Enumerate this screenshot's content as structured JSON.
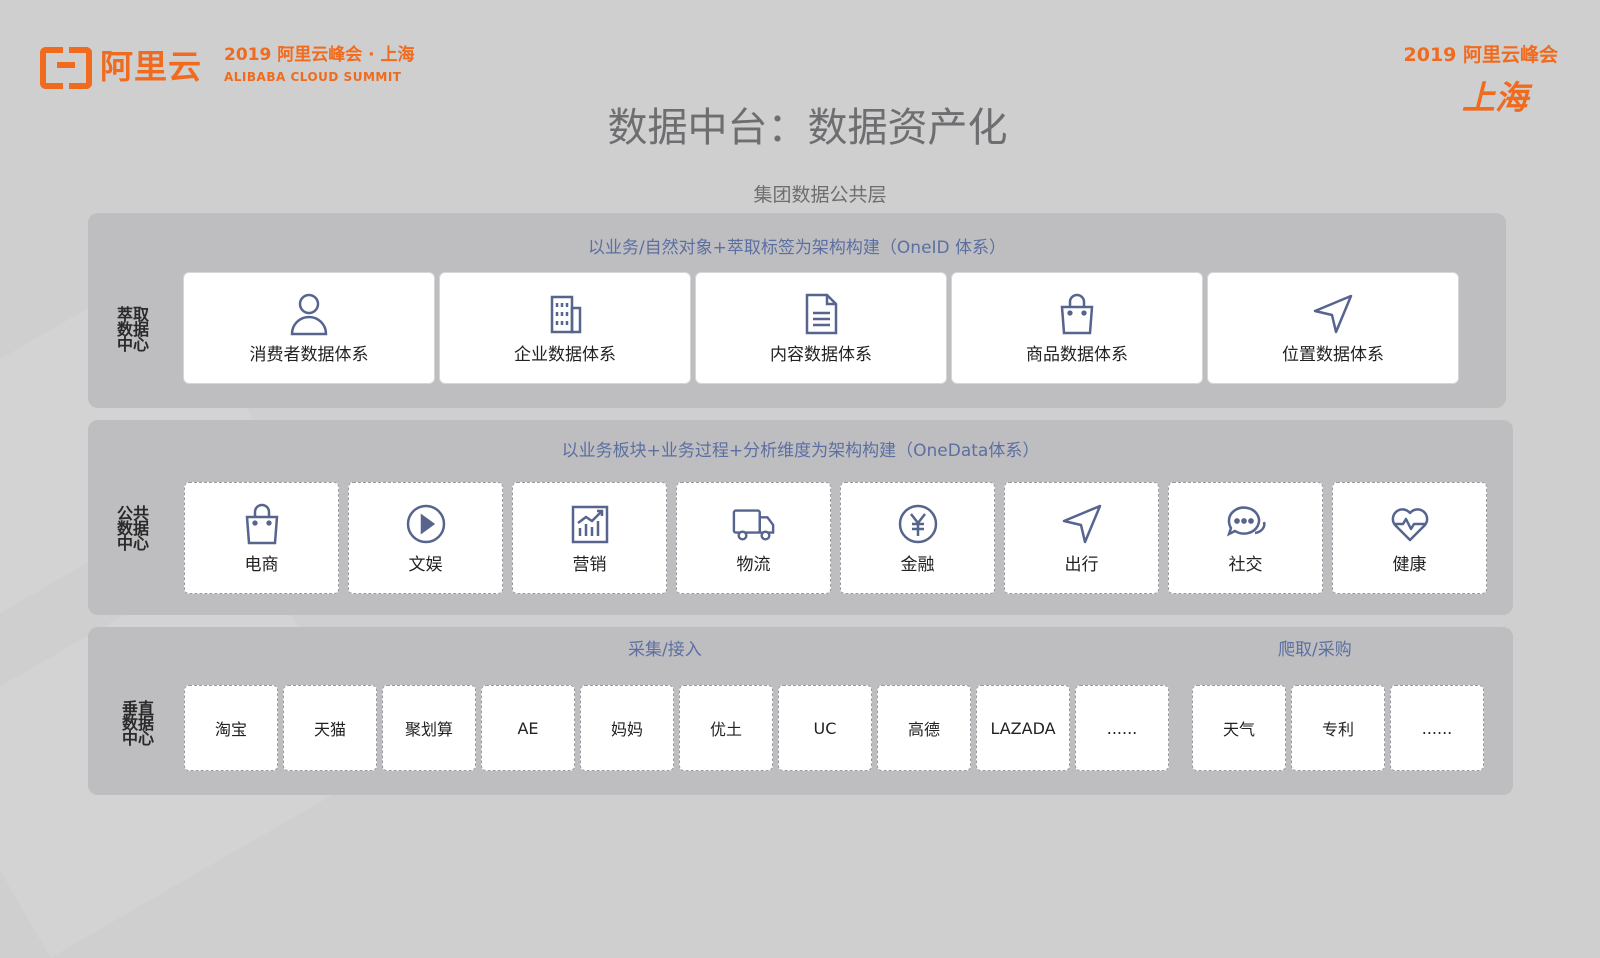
{
  "header": {
    "logo_text": "阿里云",
    "summit_line1": "2019 阿里云峰会 · 上海",
    "summit_line2": "ALIBABA CLOUD SUMMIT",
    "corner_line1": "2019 阿里云峰会",
    "corner_line2": "上海"
  },
  "title": "数据中台：数据资产化",
  "subtitle": "集团数据公共层",
  "panel1": {
    "heading": "以业务/自然对象+萃取标签为架构构建（OneID 体系）",
    "side": [
      "萃取",
      "数据",
      "中心"
    ],
    "cards": [
      {
        "label": "消费者数据体系",
        "icon": "user-icon"
      },
      {
        "label": "企业数据体系",
        "icon": "building-icon"
      },
      {
        "label": "内容数据体系",
        "icon": "document-icon"
      },
      {
        "label": "商品数据体系",
        "icon": "shopping-bag-icon"
      },
      {
        "label": "位置数据体系",
        "icon": "navigation-icon"
      }
    ]
  },
  "panel2": {
    "heading": "以业务板块+业务过程+分析维度为架构构建（OneData体系）",
    "side": [
      "公共",
      "数据",
      "中心"
    ],
    "cards": [
      {
        "label": "电商",
        "icon": "shopping-bag-icon"
      },
      {
        "label": "文娱",
        "icon": "play-icon"
      },
      {
        "label": "营销",
        "icon": "chart-icon"
      },
      {
        "label": "物流",
        "icon": "truck-icon"
      },
      {
        "label": "金融",
        "icon": "yuan-icon"
      },
      {
        "label": "出行",
        "icon": "navigation-icon"
      },
      {
        "label": "社交",
        "icon": "chat-icon"
      },
      {
        "label": "健康",
        "icon": "heart-pulse-icon"
      }
    ]
  },
  "panel3": {
    "heading_left": "采集/接入",
    "heading_right": "爬取/采购",
    "side": [
      "垂直",
      "数据",
      "中心"
    ],
    "tiles_left": [
      "淘宝",
      "天猫",
      "聚划算",
      "AE",
      "妈妈",
      "优土",
      "UC",
      "高德",
      "LAZADA",
      "......"
    ],
    "tiles_right": [
      "天气",
      "专利",
      "......"
    ]
  },
  "colors": {
    "brand": "#f06b1e",
    "accent": "#5c6fa0",
    "icon": "#56648e"
  }
}
